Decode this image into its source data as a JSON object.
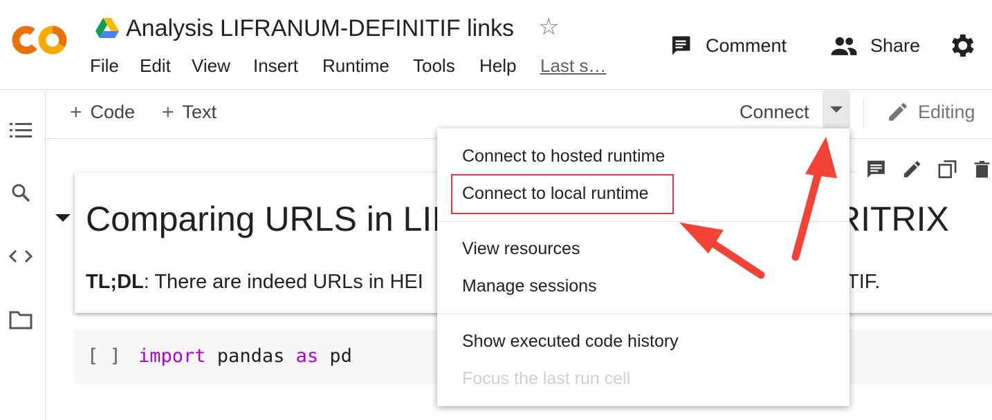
{
  "header": {
    "doc_title": "Analysis LIFRANUM-DEFINITIF links",
    "menu": [
      "File",
      "Edit",
      "View",
      "Insert",
      "Runtime",
      "Tools",
      "Help"
    ],
    "last_saved": "Last s…",
    "comment_label": "Comment",
    "share_label": "Share"
  },
  "toolbar": {
    "add_code": "Code",
    "add_text": "Text",
    "connect_label": "Connect",
    "editing_label": "Editing"
  },
  "runtime_menu": {
    "items": [
      {
        "label": "Connect to hosted runtime"
      },
      {
        "label": "Connect to local runtime"
      },
      {
        "label": "View resources"
      },
      {
        "label": "Manage sessions"
      },
      {
        "label": "Show executed code history"
      },
      {
        "label": "Focus the last run cell"
      }
    ]
  },
  "notebook": {
    "heading_start": "Comparing URLS in LII",
    "heading_end": "RITRIX",
    "tldr_bold": "TL;DL",
    "tldr_rest": ": There are indeed URLs in HEI",
    "tldr_end": "TIF.",
    "code_bracket": "[ ]",
    "code": {
      "kw1": "import",
      "mid": " pandas ",
      "kw2": "as",
      "end": " pd"
    }
  },
  "colors": {
    "logo_orange": "#f9ab00",
    "logo_deep_orange": "#e8710a",
    "annotation_red": "#f44336",
    "keyword_purple": "#af00db"
  },
  "icons": [
    "colab-logo",
    "drive-icon",
    "star-icon",
    "comment-icon",
    "people-icon",
    "gear-icon",
    "toc-icon",
    "search-icon",
    "code-icon",
    "folder-icon",
    "caret-down-icon",
    "pencil-icon",
    "cell-comment-icon",
    "cell-edit-icon",
    "cell-mirror-icon",
    "trash-icon"
  ]
}
